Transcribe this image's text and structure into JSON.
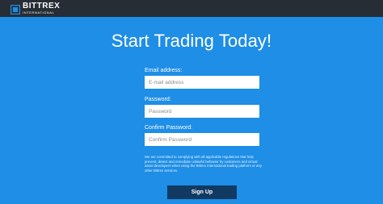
{
  "header": {
    "brand_name": "BITTREX",
    "brand_sub": "INTERNATIONAL",
    "brand_color": "#1e8ee6",
    "bar_color": "#262d35"
  },
  "main": {
    "title": "Start Trading Today!",
    "background_color": "#1e8ee6"
  },
  "form": {
    "email": {
      "label": "Email address:",
      "placeholder": "E-mail address",
      "value": ""
    },
    "password": {
      "label": "Password:",
      "placeholder": "Password",
      "value": ""
    },
    "confirm_password": {
      "label": "Confirm Password:",
      "placeholder": "Confirm Password",
      "value": ""
    },
    "disclaimer": "We are committed to complying with all applicable regulations that help prevent, detect and remediate unlawful behavior by customers and virtual asset developers when using the Bittrex International trading platform or any other Bittrex services.",
    "submit_label": "Sign Up",
    "submit_color": "#113a63"
  }
}
